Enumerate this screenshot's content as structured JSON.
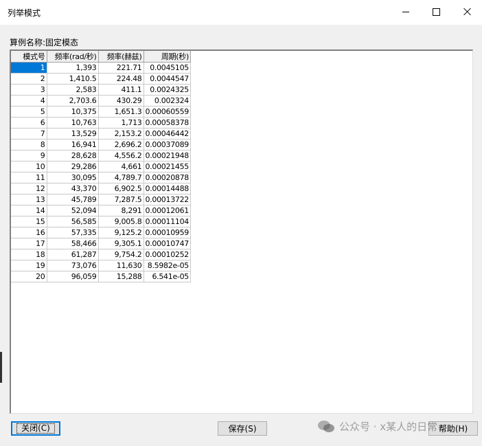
{
  "window": {
    "title": "列举模式",
    "controls": {
      "minimize": "minimize-icon",
      "maximize": "maximize-icon",
      "close": "close-icon"
    }
  },
  "case_label": "算例名称:固定模态",
  "table": {
    "headers": [
      "模式号",
      "频率(rad/秒)",
      "频率(赫兹)",
      "周期(秒)"
    ],
    "rows": [
      [
        "1",
        "1,393",
        "221.71",
        "0.0045105"
      ],
      [
        "2",
        "1,410.5",
        "224.48",
        "0.0044547"
      ],
      [
        "3",
        "2,583",
        "411.1",
        "0.0024325"
      ],
      [
        "4",
        "2,703.6",
        "430.29",
        "0.002324"
      ],
      [
        "5",
        "10,375",
        "1,651.3",
        "0.00060559"
      ],
      [
        "6",
        "10,763",
        "1,713",
        "0.00058378"
      ],
      [
        "7",
        "13,529",
        "2,153.2",
        "0.00046442"
      ],
      [
        "8",
        "16,941",
        "2,696.2",
        "0.00037089"
      ],
      [
        "9",
        "28,628",
        "4,556.2",
        "0.00021948"
      ],
      [
        "10",
        "29,286",
        "4,661",
        "0.00021455"
      ],
      [
        "11",
        "30,095",
        "4,789.7",
        "0.00020878"
      ],
      [
        "12",
        "43,370",
        "6,902.5",
        "0.00014488"
      ],
      [
        "13",
        "45,789",
        "7,287.5",
        "0.00013722"
      ],
      [
        "14",
        "52,094",
        "8,291",
        "0.00012061"
      ],
      [
        "15",
        "56,585",
        "9,005.8",
        "0.00011104"
      ],
      [
        "16",
        "57,335",
        "9,125.2",
        "0.00010959"
      ],
      [
        "17",
        "58,466",
        "9,305.1",
        "0.00010747"
      ],
      [
        "18",
        "61,287",
        "9,754.2",
        "0.00010252"
      ],
      [
        "19",
        "73,076",
        "11,630",
        "8.5982e-05"
      ],
      [
        "20",
        "96,059",
        "15,288",
        "6.541e-05"
      ]
    ],
    "selected_row": 0
  },
  "buttons": {
    "close": {
      "label": "关闭",
      "accel": "(C)"
    },
    "save": {
      "label": "保存",
      "accel": "(S)"
    },
    "help": {
      "label": "帮助",
      "accel": "(H)"
    }
  },
  "watermark": {
    "text": "公众号 · x某人的日常"
  },
  "colors": {
    "selection": "#0078d7",
    "background": "#f0f0f0"
  }
}
